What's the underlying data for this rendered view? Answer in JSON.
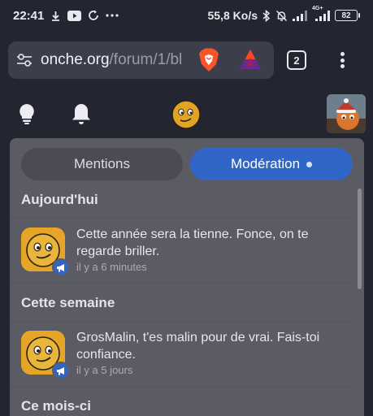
{
  "status_bar": {
    "time": "22:41",
    "network_speed": "55,8 Ko/s",
    "network_type": "4G+",
    "battery_level": "82"
  },
  "browser": {
    "url_domain": "onche.org",
    "url_path": "/forum/1/bl",
    "tab_count": "2"
  },
  "notifications_panel": {
    "tabs": [
      {
        "label": "Mentions",
        "active": false
      },
      {
        "label": "Modération",
        "active": true,
        "has_unread": true
      }
    ],
    "sections": [
      {
        "title": "Aujourd'hui",
        "items": [
          {
            "message": "Cette année sera la tienne. Fonce, on te regarde briller.",
            "time": "il y a 6 minutes"
          }
        ]
      },
      {
        "title": "Cette semaine",
        "items": [
          {
            "message": "GrosMalin, t'es malin pour de vrai. Fais-toi confiance.",
            "time": "il y a 5 jours"
          }
        ]
      },
      {
        "title": "Ce mois-ci",
        "items": []
      }
    ]
  },
  "colors": {
    "accent": "#2f66c8",
    "panel_bg": "#5b5c63",
    "page_bg": "#232531",
    "app_icon": "#e6a526"
  }
}
